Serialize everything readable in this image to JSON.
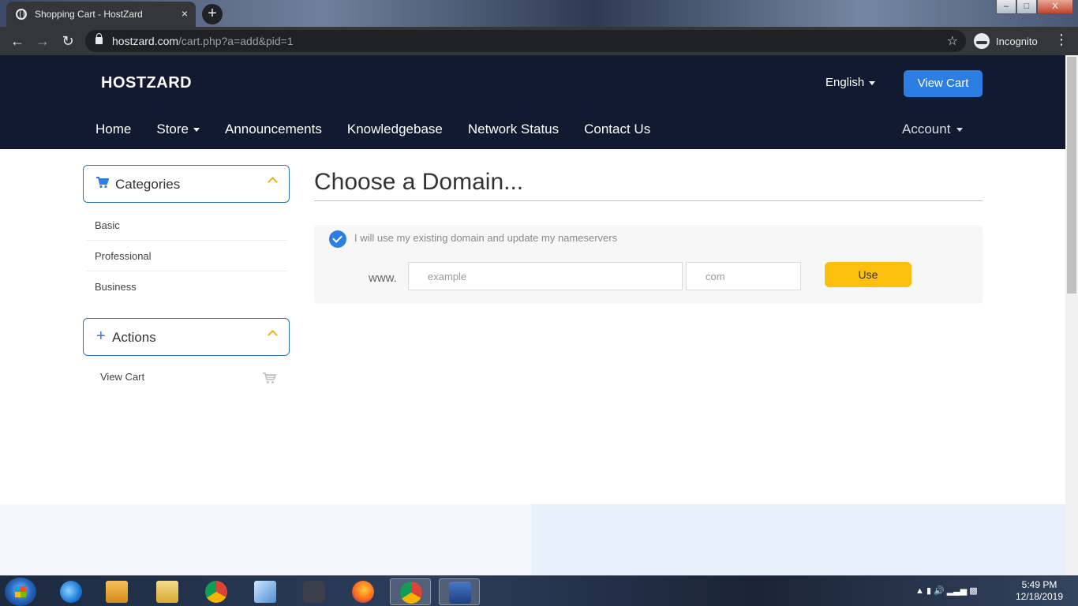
{
  "browser": {
    "tab_title": "Shopping Cart - HostZard",
    "tab_close": "×",
    "new_tab": "+",
    "url_host": "hostzard.com",
    "url_path": "/cart.php?a=add&pid=1",
    "profile_label": "Incognito",
    "window_controls": {
      "minimize": "–",
      "maximize": "□",
      "close": "X"
    }
  },
  "header": {
    "logo": "HOSTZARD",
    "language": "English",
    "view_cart_button": "View Cart",
    "nav": [
      "Home",
      "Store",
      "Announcements",
      "Knowledgebase",
      "Network Status",
      "Contact Us"
    ],
    "account": "Account"
  },
  "sidebar": {
    "categories_title": "Categories",
    "categories": [
      "Basic",
      "Professional",
      "Business"
    ],
    "actions_title": "Actions",
    "actions": [
      "View Cart"
    ]
  },
  "main": {
    "title": "Choose a Domain...",
    "option_label": "I will use my existing domain and update my nameservers",
    "www_prefix": "www.",
    "sld_placeholder": "example",
    "tld_placeholder": "com",
    "use_button": "Use"
  },
  "taskbar": {
    "time": "5:49 PM",
    "date": "12/18/2019",
    "apps": [
      "internet-explorer",
      "media-player",
      "file-explorer",
      "chrome",
      "notepad",
      "nox",
      "firefox",
      "chrome-active",
      "malwarebytes"
    ]
  },
  "colors": {
    "header_bg": "#111a30",
    "accent_blue": "#2d7ee3",
    "use_button": "#fbc00d"
  }
}
